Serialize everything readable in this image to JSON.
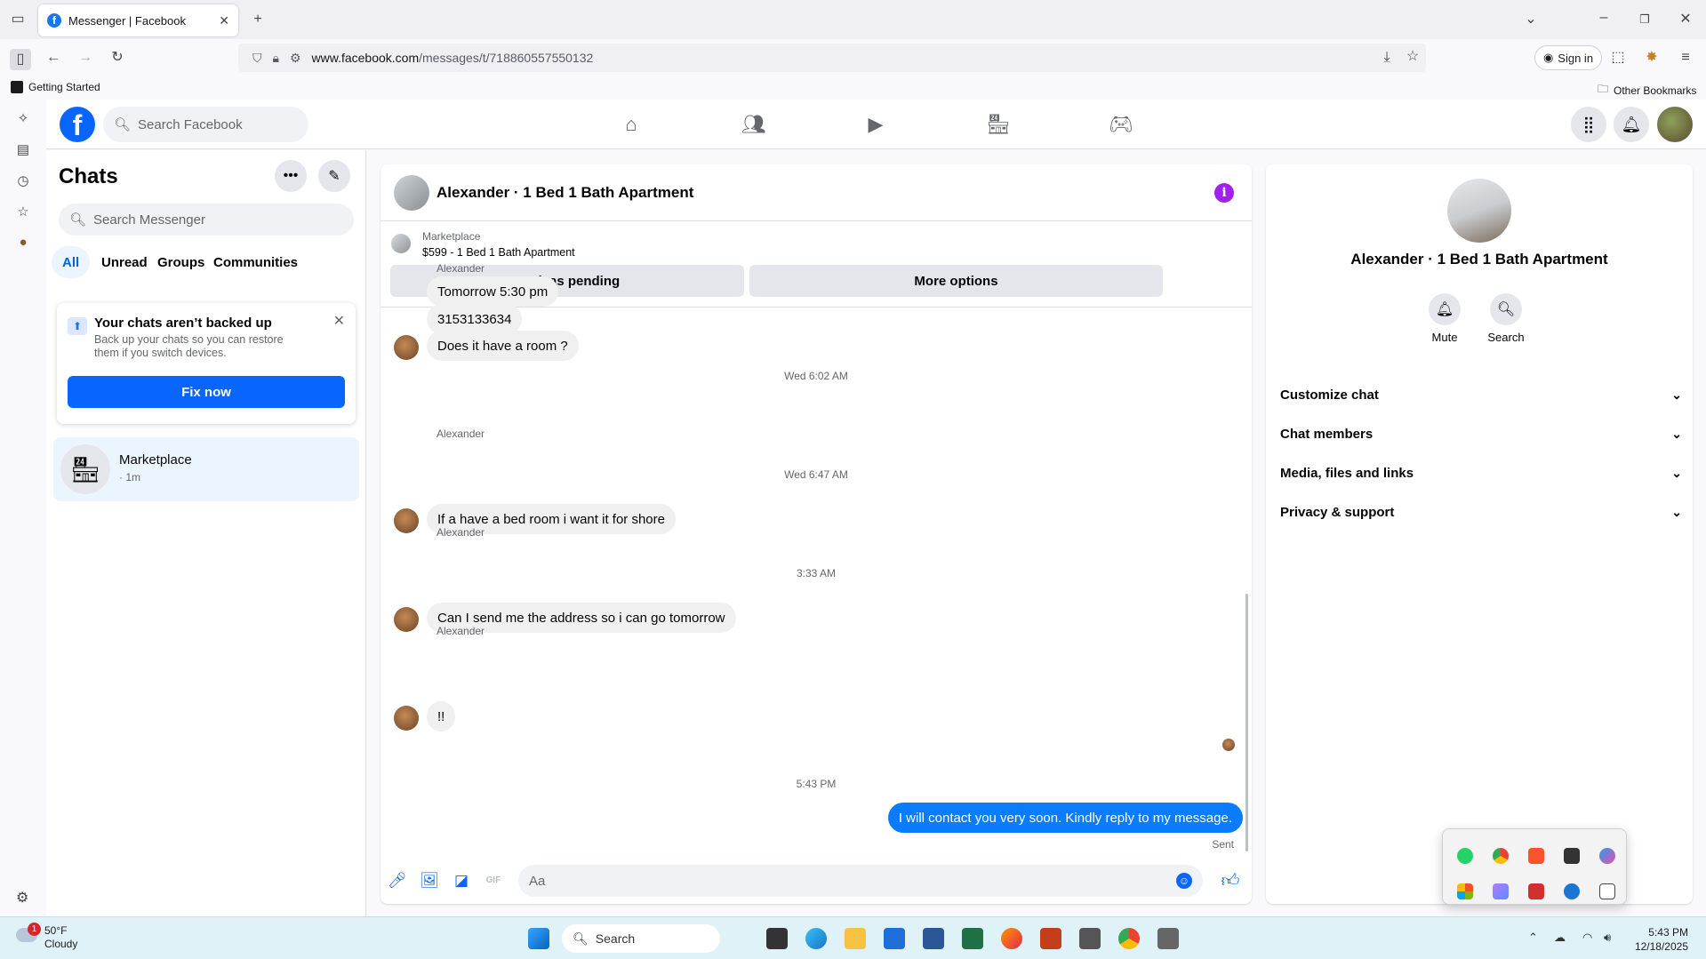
{
  "browser": {
    "tab_title": "Messenger | Facebook",
    "url_host": "www.facebook.com",
    "url_path": "/messages/t/718860557550132",
    "signin_label": "Sign in",
    "bookmark_getting_started": "Getting Started",
    "bookmark_other": "Other Bookmarks"
  },
  "fb": {
    "search_placeholder": "Search Facebook",
    "nav_icons": [
      "home-icon",
      "friends-icon",
      "video-icon",
      "marketplace-icon",
      "gaming-icon"
    ]
  },
  "chats": {
    "title": "Chats",
    "search_placeholder": "Search Messenger",
    "filters": [
      "All",
      "Unread",
      "Groups",
      "Communities"
    ],
    "active_filter": "All",
    "backup": {
      "title": "Your chats aren’t backed up",
      "description": "Back up your chats so you can restore them if you switch devices.",
      "button": "Fix now"
    },
    "conversation": {
      "name": "Marketplace",
      "time": "· 1m"
    }
  },
  "conversation": {
    "title": "Alexander · 1 Bed 1 Bath Apartment",
    "marketplace_label": "Marketplace",
    "listing": "$599 - 1 Bed 1 Bath Apartment",
    "mark_pending": "Mark as pending",
    "more_options": "More options",
    "sender": "Alexander",
    "messages": [
      "Tomorrow 5:30 pm",
      "3153133634",
      "Does it have a room ?",
      "If a have a bed room i want it for shore",
      "Can I send me the address so i can go tomorrow",
      "!!",
      "I will contact you very soon. Kindly reply to my message."
    ],
    "timestamps": [
      "Wed 6:02 AM",
      "Wed 6:47 AM",
      "3:33 AM",
      "5:43 PM"
    ],
    "sent_status": "Sent",
    "composer_placeholder": "Aa"
  },
  "details": {
    "name": "Alexander · 1 Bed 1 Bath Apartment",
    "mute_label": "Mute",
    "search_label": "Search",
    "sections": [
      "Customize chat",
      "Chat members",
      "Media, files and links",
      "Privacy & support"
    ]
  },
  "taskbar": {
    "temperature": "50°F",
    "condition": "Cloudy",
    "weather_badge": "1",
    "search_label": "Search",
    "time": "5:43 PM",
    "date": "12/18/2025"
  },
  "colors": {
    "fb_blue": "#0866ff",
    "my_bubble": "#0a7cff",
    "info_purple": "#a020f0"
  }
}
